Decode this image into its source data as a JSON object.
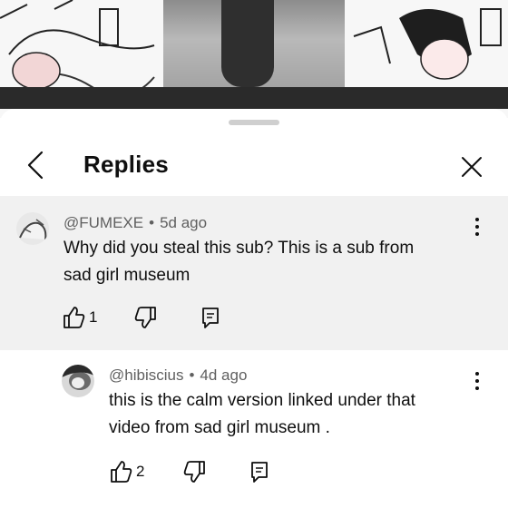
{
  "sheet": {
    "title": "Replies",
    "icons": {
      "back": "chevron-left-icon",
      "close": "close-icon"
    }
  },
  "comments": [
    {
      "author": "@FUMEXE",
      "separator": "•",
      "time": "5d ago",
      "text_line1": "Why did you steal this sub? This is a sub from",
      "text_line2": "sad girl museum",
      "likes": "1"
    },
    {
      "author": "@hibiscius",
      "separator": "•",
      "time": "4d ago",
      "text_line1": "this is the calm version linked under that",
      "text_line2": "video from sad girl museum .",
      "likes": "2"
    }
  ],
  "colors": {
    "highlight_bg": "#f1f1f1",
    "meta": "#606060",
    "text": "#0f0f0f"
  }
}
